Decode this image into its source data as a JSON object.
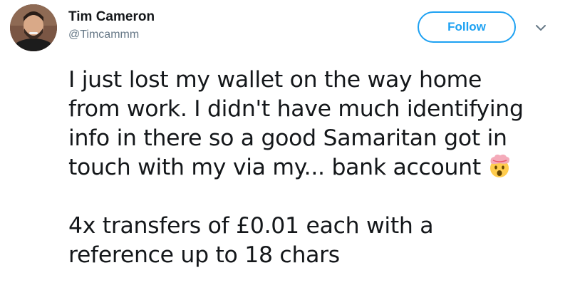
{
  "author": {
    "display_name": "Tim Cameron",
    "handle": "@Timcammm"
  },
  "actions": {
    "follow_label": "Follow"
  },
  "tweet": {
    "paragraph1": "I just lost my wallet on the way home\nfrom work. I didn't have much identifying\ninfo in there so a good Samaritan got in\ntouch with my via my... bank account",
    "paragraph2": "4x transfers of £0.01 each with a\nreference up to 18 chars",
    "emoji": "exploding-head-emoji"
  },
  "colors": {
    "accent": "#1da1f2",
    "text": "#14171a",
    "secondary": "#657786"
  },
  "icons": {
    "menu": "chevron-down-icon"
  }
}
